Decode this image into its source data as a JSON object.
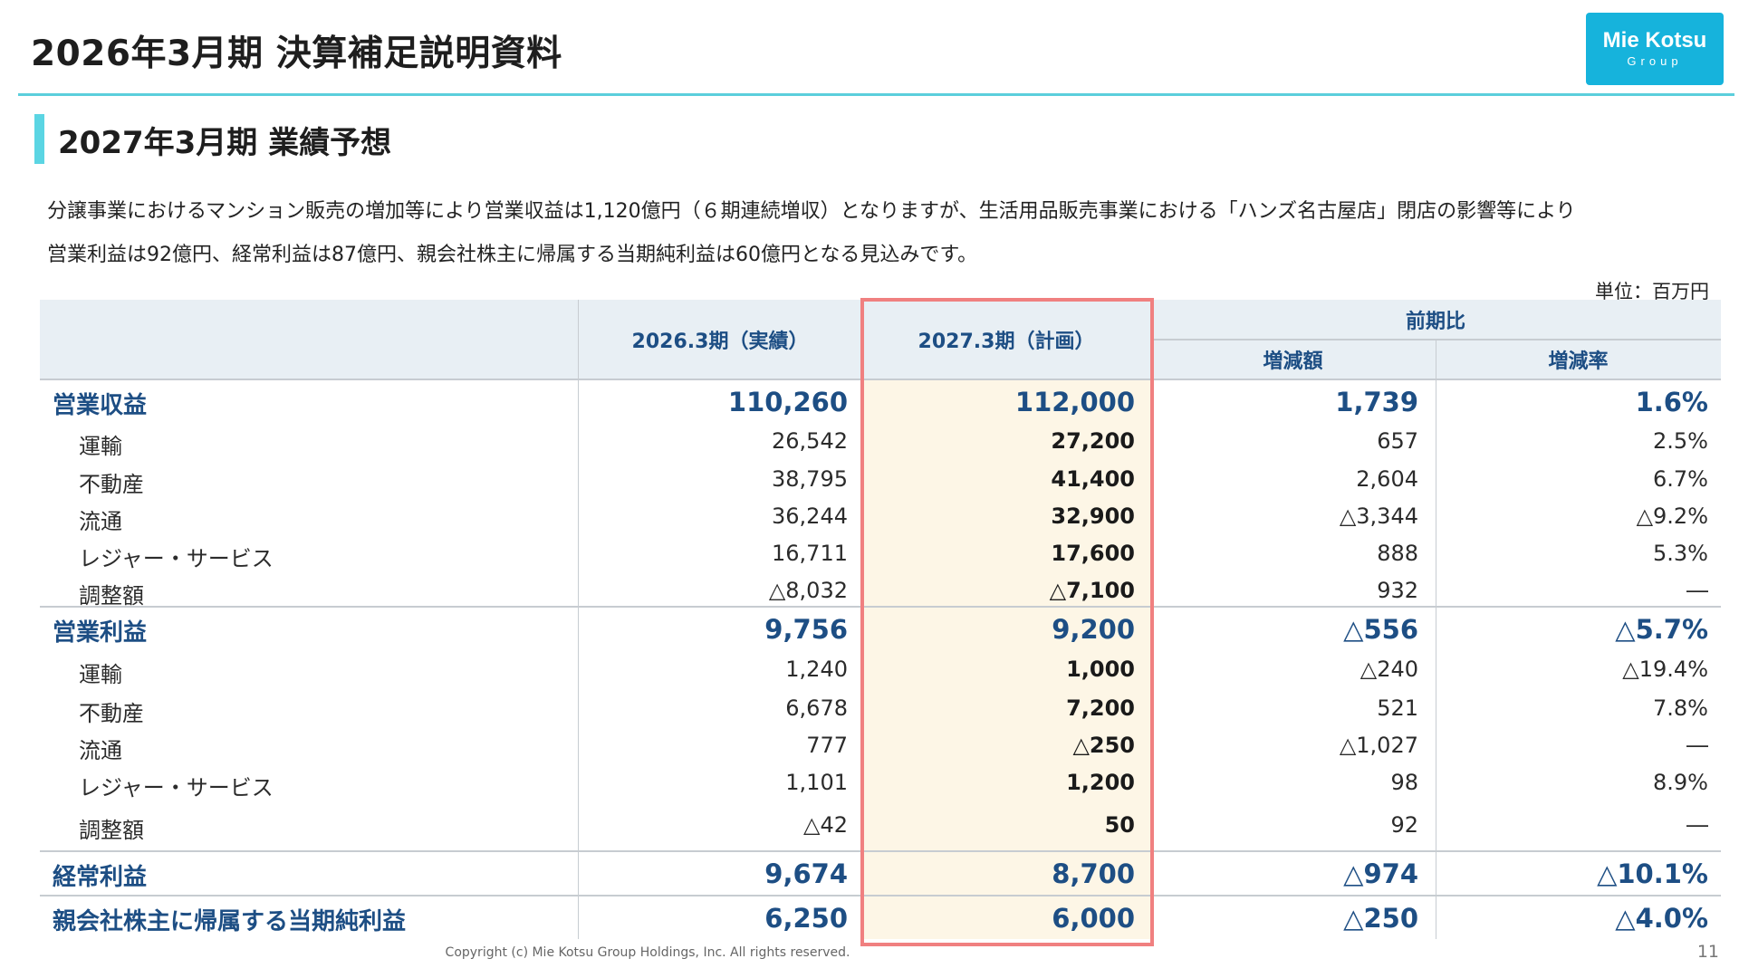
{
  "header": {
    "title": "2026年3月期 決算補足説明資料"
  },
  "logo": {
    "main": "Mie Kotsu",
    "sub": "Group"
  },
  "section": {
    "title": "2027年3月期 業績予想"
  },
  "description": {
    "line1": "分譲事業におけるマンション販売の増加等により営業収益は1,120億円（６期連続増収）となりますが、生活用品販売事業における「ハンズ名古屋店」閉店の影響等により",
    "line2": "営業利益は92億円、経常利益は87億円、親会社株主に帰属する当期純利益は60億円となる見込みです。"
  },
  "unit_label": "単位：百万円",
  "table": {
    "headers": {
      "actual": "2026.3期（実績）",
      "plan": "2027.3期（計画）",
      "comparison": "前期比",
      "diff": "増減額",
      "rate": "増減率"
    },
    "rows": [
      {
        "name": "営業収益",
        "actual": "110,260",
        "plan": "112,000",
        "diff": "1,739",
        "rate": "1.6%"
      },
      {
        "name": "運輸",
        "actual": "26,542",
        "plan": "27,200",
        "diff": "657",
        "rate": "2.5%"
      },
      {
        "name": "不動産",
        "actual": "38,795",
        "plan": "41,400",
        "diff": "2,604",
        "rate": "6.7%"
      },
      {
        "name": "流通",
        "actual": "36,244",
        "plan": "32,900",
        "diff": "△3,344",
        "rate": "△9.2%"
      },
      {
        "name": "レジャー・サービス",
        "actual": "16,711",
        "plan": "17,600",
        "diff": "888",
        "rate": "5.3%"
      },
      {
        "name": "調整額",
        "actual": "△8,032",
        "plan": "△7,100",
        "diff": "932",
        "rate": "―"
      },
      {
        "name": "営業利益",
        "actual": "9,756",
        "plan": "9,200",
        "diff": "△556",
        "rate": "△5.7%"
      },
      {
        "name": "運輸",
        "actual": "1,240",
        "plan": "1,000",
        "diff": "△240",
        "rate": "△19.4%"
      },
      {
        "name": "不動産",
        "actual": "6,678",
        "plan": "7,200",
        "diff": "521",
        "rate": "7.8%"
      },
      {
        "name": "流通",
        "actual": "777",
        "plan": "△250",
        "diff": "△1,027",
        "rate": "―"
      },
      {
        "name": "レジャー・サービス",
        "actual": "1,101",
        "plan": "1,200",
        "diff": "98",
        "rate": "8.9%"
      },
      {
        "name": "調整額",
        "actual": "△42",
        "plan": "50",
        "diff": "92",
        "rate": "―"
      },
      {
        "name": "経常利益",
        "actual": "9,674",
        "plan": "8,700",
        "diff": "△974",
        "rate": "△10.1%"
      },
      {
        "name": "親会社株主に帰属する当期純利益",
        "actual": "6,250",
        "plan": "6,000",
        "diff": "△250",
        "rate": "△4.0%"
      }
    ]
  },
  "footer": {
    "copyright": "Copyright (c) Mie Kotsu Group Holdings, Inc. All rights reserved.",
    "page": "11"
  }
}
